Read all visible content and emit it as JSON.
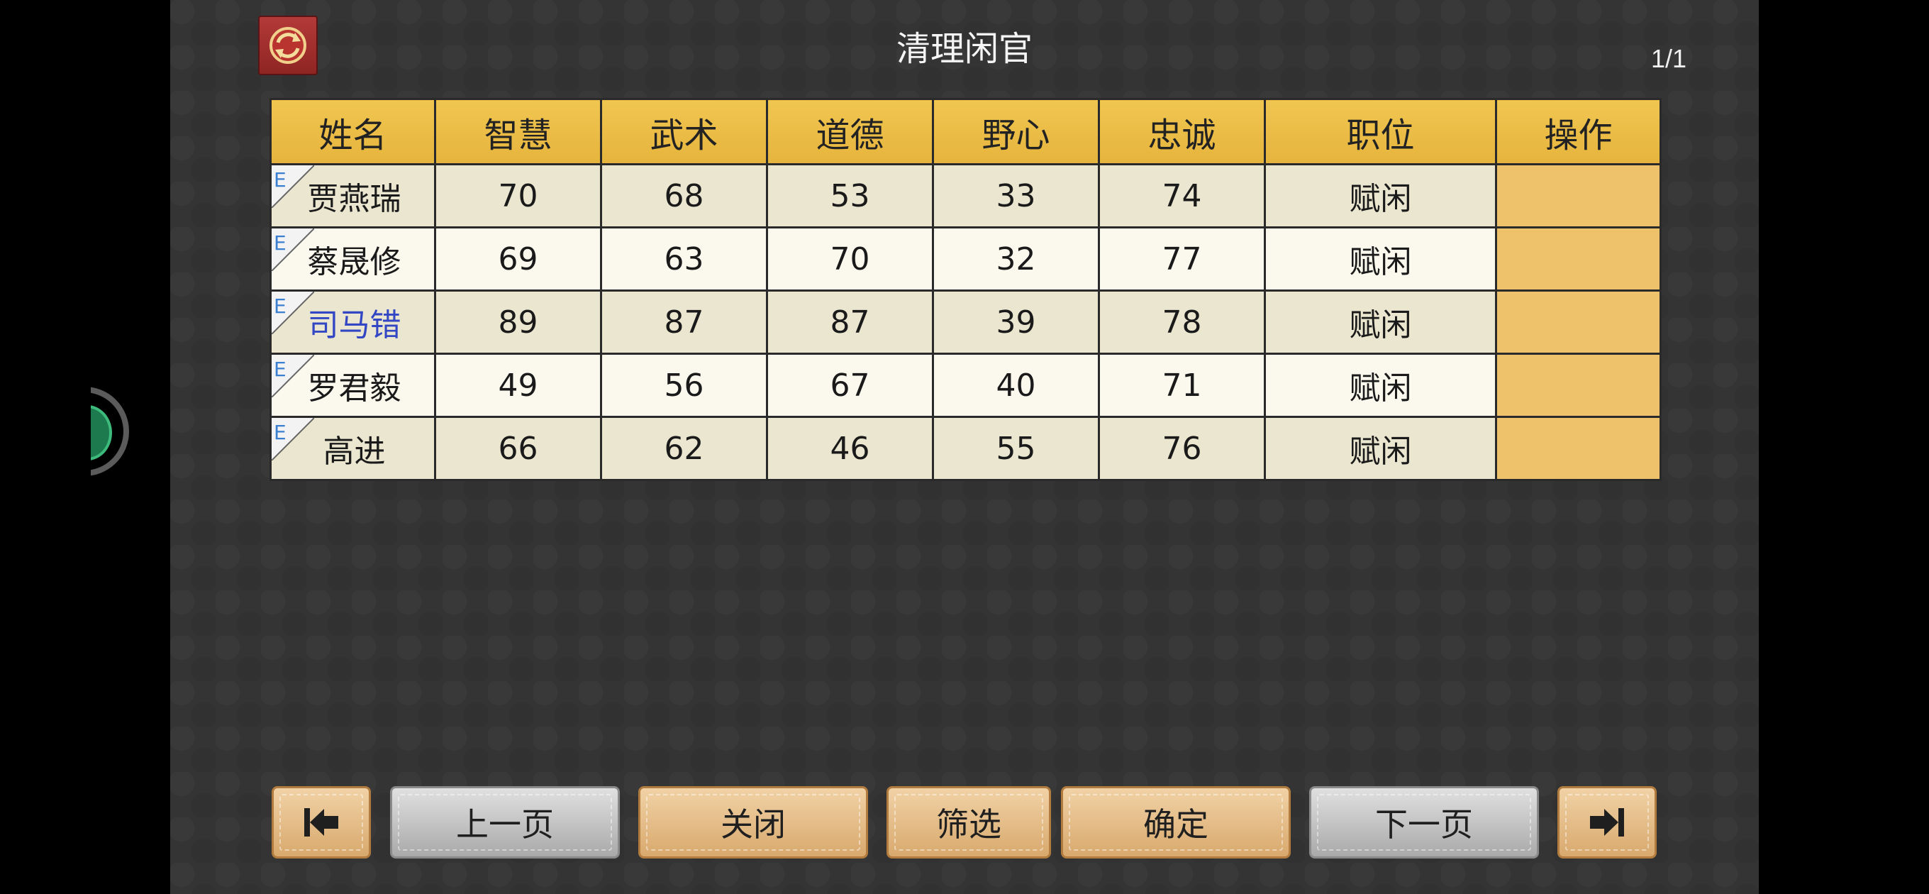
{
  "title": "清理闲官",
  "page_counter": "1/1",
  "table": {
    "headers": [
      "姓名",
      "智慧",
      "武术",
      "道德",
      "野心",
      "忠诚",
      "职位",
      "操作"
    ],
    "rows": [
      {
        "rank": "E",
        "name": "贾燕瑞",
        "wisdom": "70",
        "martial": "68",
        "morality": "53",
        "ambition": "33",
        "loyalty": "74",
        "position": "赋闲",
        "highlighted": false
      },
      {
        "rank": "E",
        "name": "蔡晟修",
        "wisdom": "69",
        "martial": "63",
        "morality": "70",
        "ambition": "32",
        "loyalty": "77",
        "position": "赋闲",
        "highlighted": false
      },
      {
        "rank": "E",
        "name": "司马错",
        "wisdom": "89",
        "martial": "87",
        "morality": "87",
        "ambition": "39",
        "loyalty": "78",
        "position": "赋闲",
        "highlighted": true
      },
      {
        "rank": "E",
        "name": "罗君毅",
        "wisdom": "49",
        "martial": "56",
        "morality": "67",
        "ambition": "40",
        "loyalty": "71",
        "position": "赋闲",
        "highlighted": false
      },
      {
        "rank": "E",
        "name": "高进",
        "wisdom": "66",
        "martial": "62",
        "morality": "46",
        "ambition": "55",
        "loyalty": "76",
        "position": "赋闲",
        "highlighted": false
      }
    ]
  },
  "buttons": {
    "first_page_icon": "first-page-icon",
    "prev_page": "上一页",
    "close": "关闭",
    "filter": "筛选",
    "confirm": "确定",
    "next_page": "下一页",
    "last_page_icon": "last-page-icon"
  },
  "colors": {
    "header_gold": "#e9b942",
    "operation_cell": "#eec26a",
    "highlight_name": "#3347c4",
    "refresh_button": "#a63331"
  }
}
